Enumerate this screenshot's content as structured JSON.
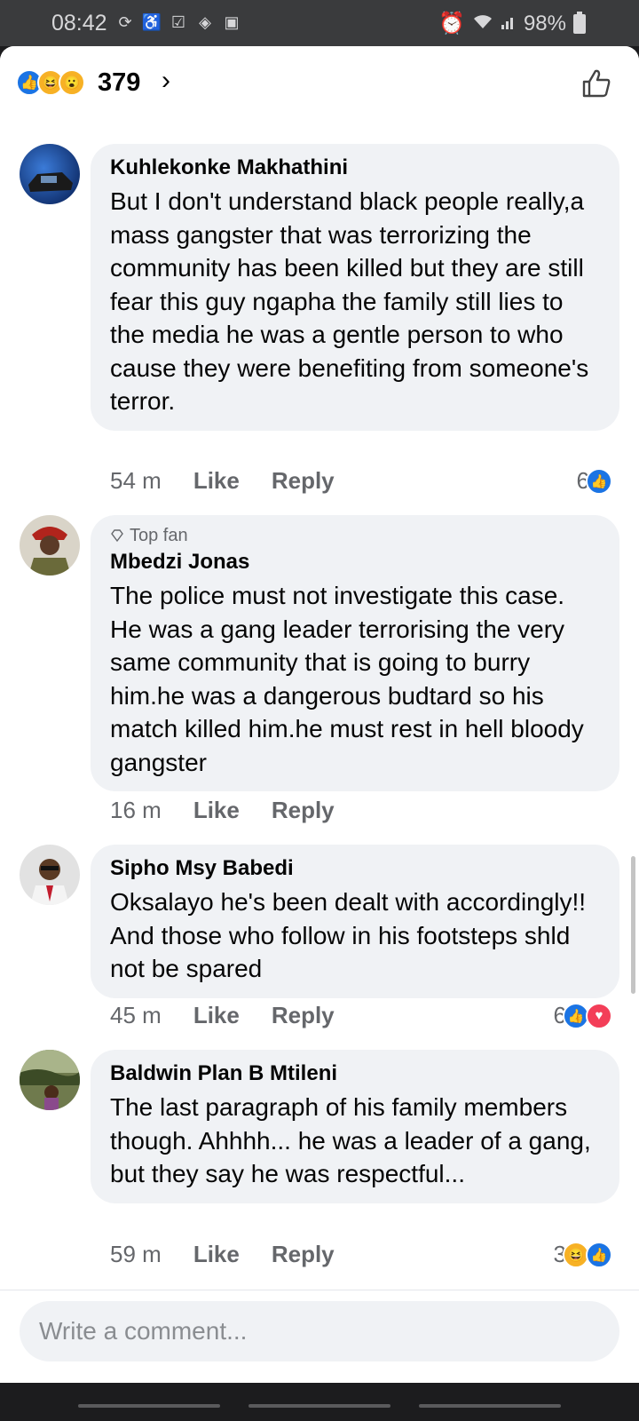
{
  "status_bar": {
    "time": "08:42",
    "battery": "98%",
    "icons": [
      "sync-icon",
      "accessibility-icon",
      "checkbox-icon",
      "code-icon",
      "image-icon"
    ],
    "right_icons": [
      "alarm-icon",
      "wifi-icon",
      "signal-icon",
      "battery-icon"
    ]
  },
  "header": {
    "reaction_count": "379",
    "chevron": "›",
    "reactions": [
      "like",
      "haha",
      "wow"
    ]
  },
  "comments": [
    {
      "name": "Kuhlekonke Makhathini",
      "text": "But I don't understand black people really,a mass gangster that was terrorizing the community has been killed but they are still fear this guy ngapha the family still lies to the media he was a gentle person to who cause they were benefiting from someone's terror.",
      "time": "54 m",
      "like": "Like",
      "reply": "Reply",
      "reaction_count": "6",
      "reactions": [
        "like"
      ]
    },
    {
      "badge": "Top fan",
      "name": "Mbedzi Jonas",
      "text": "The police must not investigate this case. He was a gang leader terrorising the very same community that is going to burry him.he was a dangerous budtard so his match killed him.he must rest in hell bloody gangster",
      "time": "16 m",
      "like": "Like",
      "reply": "Reply"
    },
    {
      "name": "Sipho Msy Babedi",
      "text": "Oksalayo he's been dealt with accordingly!! And those who follow in his footsteps shld not be spared",
      "time": "45 m",
      "like": "Like",
      "reply": "Reply",
      "reaction_count": "6",
      "reactions": [
        "like",
        "love"
      ]
    },
    {
      "name": "Baldwin Plan B Mtileni",
      "text": "The last paragraph of his family members though. Ahhhh... he was a leader of a gang, but they say he was respectful...",
      "time": "59 m",
      "like": "Like",
      "reply": "Reply",
      "reaction_count": "3",
      "reactions": [
        "haha",
        "like"
      ]
    }
  ],
  "composer": {
    "placeholder": "Write a comment..."
  },
  "colors": {
    "accent": "#1b74e4",
    "love": "#f33e58",
    "bubble": "#f0f2f5",
    "secondary_text": "#65676b"
  }
}
